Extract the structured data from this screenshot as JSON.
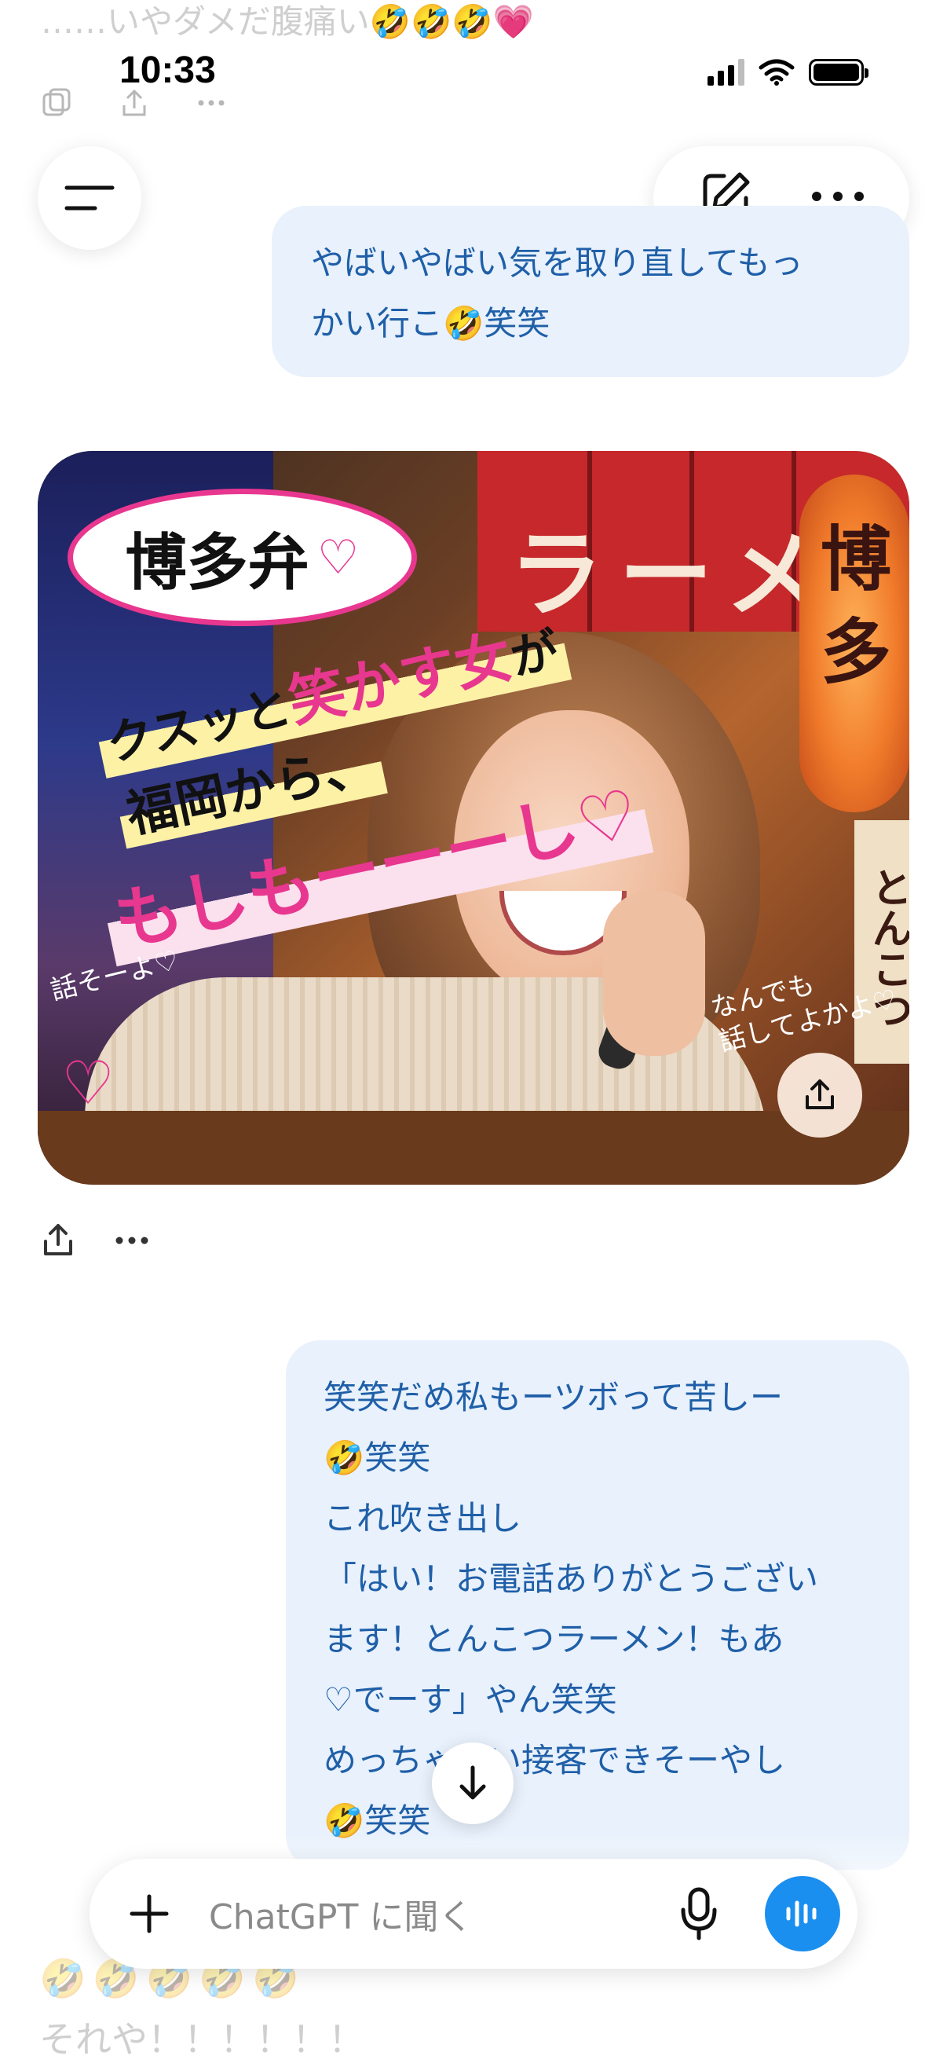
{
  "status_bar": {
    "time": "10:33"
  },
  "previous_message_fade": "……いやダメだ腹痛い🤣🤣🤣💗",
  "top_actions": {
    "menu_icon": "hamburger-icon",
    "new_chat_icon": "edit-icon",
    "more_icon": "ellipsis-icon"
  },
  "messages": [
    {
      "role": "user",
      "lines": [
        "やばいやばい気を取り直してもっ",
        "かい行こ🤣笑笑"
      ]
    },
    {
      "role": "assistant",
      "type": "image",
      "image_text": {
        "speech_bubble": "博多弁",
        "speech_heart": "♡",
        "caption_line1_a": "クスッと",
        "caption_line1_b": "笑かす女",
        "caption_line1_c": "が",
        "caption_line2": "福岡から、",
        "caption_line3": "もしもーーーし♡",
        "note_left": "話そーよ♡",
        "note_right_1": "なんでも",
        "note_right_2": "話してよかよ♡",
        "noren": "ラーメン",
        "lantern": "博多",
        "sign": "とんこつ",
        "pink_heart": "♡"
      }
    },
    {
      "role": "user",
      "lines": [
        "笑笑だめ私もーツボって苦しー",
        "🤣笑笑",
        "これ吹き出し",
        "「はい！お電話ありがとうござい",
        "ます！とんこつラーメン！もあ",
        "♡でーす」やん笑笑",
        "めっちゃいい接客できそーやし",
        "🤣笑笑"
      ]
    }
  ],
  "bottom_fade": {
    "emojis": "🤣🤣🤣🤣🤣",
    "text": "それや！！！！！！"
  },
  "composer": {
    "placeholder": "ChatGPT に聞く"
  },
  "colors": {
    "user_bubble_bg": "#e8f1fc",
    "user_bubble_text": "#1f5fa8",
    "voice_button": "#1a8ff0",
    "accent_pink": "#e8378f"
  }
}
